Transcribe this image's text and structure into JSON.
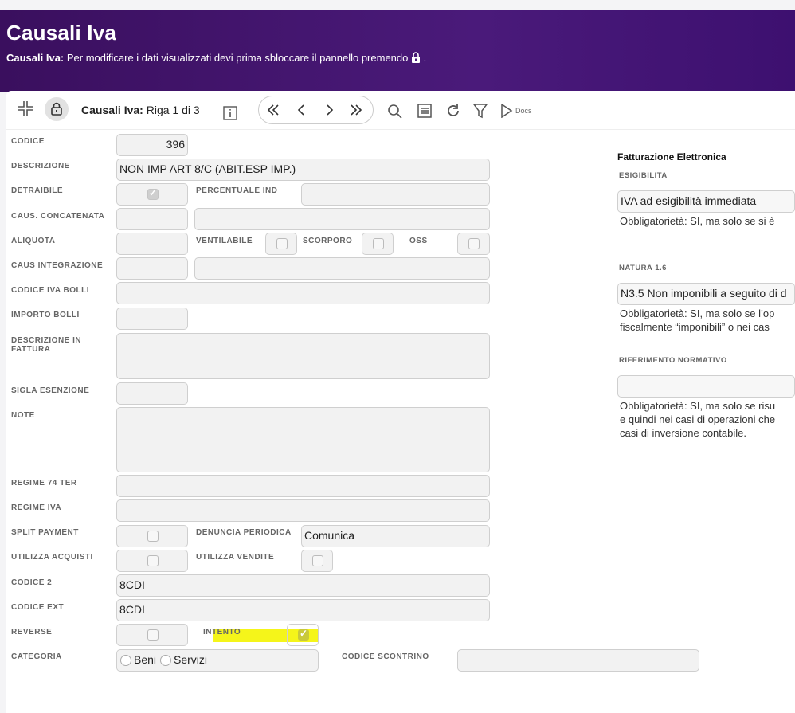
{
  "header": {
    "title": "Causali Iva",
    "subtitle_bold": "Causali Iva:",
    "subtitle_text": "Per modificare i dati visualizzati devi prima sbloccare il pannello premendo",
    "subtitle_end": "."
  },
  "toolbar": {
    "entity": "Causali Iva:",
    "record": "Riga 1 di 3",
    "docs_label": "Docs"
  },
  "form": {
    "codice": {
      "label": "CODICE",
      "value": "396"
    },
    "descrizione": {
      "label": "DESCRIZIONE",
      "value": "NON IMP ART 8/C (ABIT.ESP IMP.)"
    },
    "detraibile": {
      "label": "DETRAIBILE",
      "checked": true
    },
    "percentuale_ind": {
      "label": "PERCENTUALE IND",
      "value": ""
    },
    "caus_concatenata": {
      "label": "CAUS. CONCATENATA",
      "value": ""
    },
    "aliquota": {
      "label": "ALIQUOTA",
      "value": ""
    },
    "ventilabile": {
      "label": "VENTILABILE",
      "checked": false
    },
    "scorporo": {
      "label": "SCORPORO",
      "checked": false
    },
    "oss": {
      "label": "OSS",
      "checked": false
    },
    "caus_integrazione": {
      "label": "CAUS INTEGRAZIONE",
      "value": ""
    },
    "codice_iva_bolli": {
      "label": "CODICE IVA BOLLI",
      "value": ""
    },
    "importo_bolli": {
      "label": "IMPORTO BOLLI",
      "value": ""
    },
    "descrizione_fattura": {
      "label_line1": "DESCRIZIONE IN",
      "label_line2": "FATTURA",
      "value": ""
    },
    "sigla_esenzione": {
      "label": "SIGLA ESENZIONE",
      "value": ""
    },
    "note": {
      "label": "NOTE",
      "value": ""
    },
    "regime_74_ter": {
      "label": "REGIME 74 TER",
      "value": ""
    },
    "regime_iva": {
      "label": "REGIME IVA",
      "value": ""
    },
    "split_payment": {
      "label": "SPLIT PAYMENT",
      "checked": false
    },
    "denuncia_periodica": {
      "label": "DENUNCIA PERIODICA",
      "value": "Comunica"
    },
    "utilizza_acquisti": {
      "label": "UTILIZZA ACQUISTI",
      "checked": false
    },
    "utilizza_vendite": {
      "label": "UTILIZZA VENDITE",
      "checked": false
    },
    "codice_2": {
      "label": "CODICE 2",
      "value": "8CDI"
    },
    "codice_ext": {
      "label": "CODICE EXT",
      "value": "8CDI"
    },
    "reverse": {
      "label": "REVERSE",
      "checked": false
    },
    "intento": {
      "label": "INTENTO",
      "checked": true
    },
    "categoria": {
      "label": "CATEGORIA",
      "options": [
        "Beni",
        "Servizi"
      ]
    },
    "codice_scontrino": {
      "label": "CODICE SCONTRINO",
      "value": ""
    }
  },
  "fattura_elettronica": {
    "title": "Fatturazione Elettronica",
    "esigibilita": {
      "label": "ESIGIBILITA",
      "value": "IVA ad esigibilità immediata",
      "note": "Obbligatorietà: SI, ma solo se si è"
    },
    "natura": {
      "label": "NATURA 1.6",
      "value": "N3.5 Non imponibili a seguito di d",
      "note_line1": "Obbligatorietà: SI, ma solo se l’op",
      "note_line2": "fiscalmente “imponibili” o nei cas"
    },
    "riferimento": {
      "label": "RIFERIMENTO NORMATIVO",
      "value": "",
      "note_line1": "Obbligatorietà: SI, ma solo se risu",
      "note_line2": "e quindi nei casi di operazioni che",
      "note_line3": "casi di inversione contabile."
    }
  },
  "colors": {
    "header_bg": "#3a0f5e",
    "highlight": "#f5f51a"
  }
}
